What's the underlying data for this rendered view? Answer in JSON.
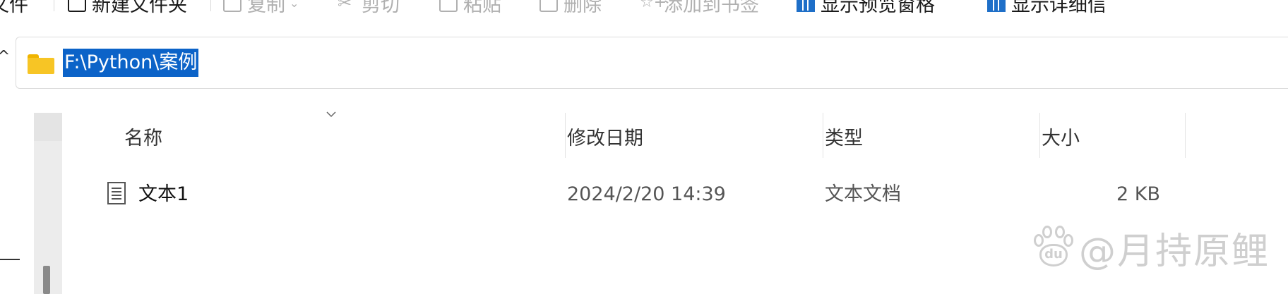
{
  "toolbar": {
    "items": [
      {
        "label": "文件",
        "enabled": true,
        "icon": "new-item-icon"
      },
      {
        "label": "新建文件夹",
        "enabled": true,
        "icon": "new-folder-icon"
      },
      {
        "label": "复制",
        "enabled": false,
        "icon": "copy-icon"
      },
      {
        "label": "剪切",
        "enabled": false,
        "icon": "cut-icon"
      },
      {
        "label": "粘贴",
        "enabled": false,
        "icon": "paste-icon"
      },
      {
        "label": "删除",
        "enabled": false,
        "icon": "delete-icon"
      },
      {
        "label": "添加到书签",
        "enabled": false,
        "icon": "bookmark-add-icon"
      },
      {
        "label": "显示预览窗格",
        "enabled": true,
        "icon": "preview-pane-icon"
      },
      {
        "label": "显示详细信",
        "enabled": true,
        "icon": "details-pane-icon"
      }
    ]
  },
  "address": {
    "path": "F:\\Python\\案例",
    "icon": "folder-icon",
    "selection_color": "#0c63c8"
  },
  "columns": {
    "name": "名称",
    "modified": "修改日期",
    "type": "类型",
    "size": "大小"
  },
  "files": [
    {
      "name": "文本1",
      "modified": "2024/2/20 14:39",
      "type": "文本文档",
      "size": "2 KB",
      "icon": "text-file-icon"
    }
  ],
  "watermark": {
    "badge": "du",
    "text": "@月持原鲤"
  }
}
